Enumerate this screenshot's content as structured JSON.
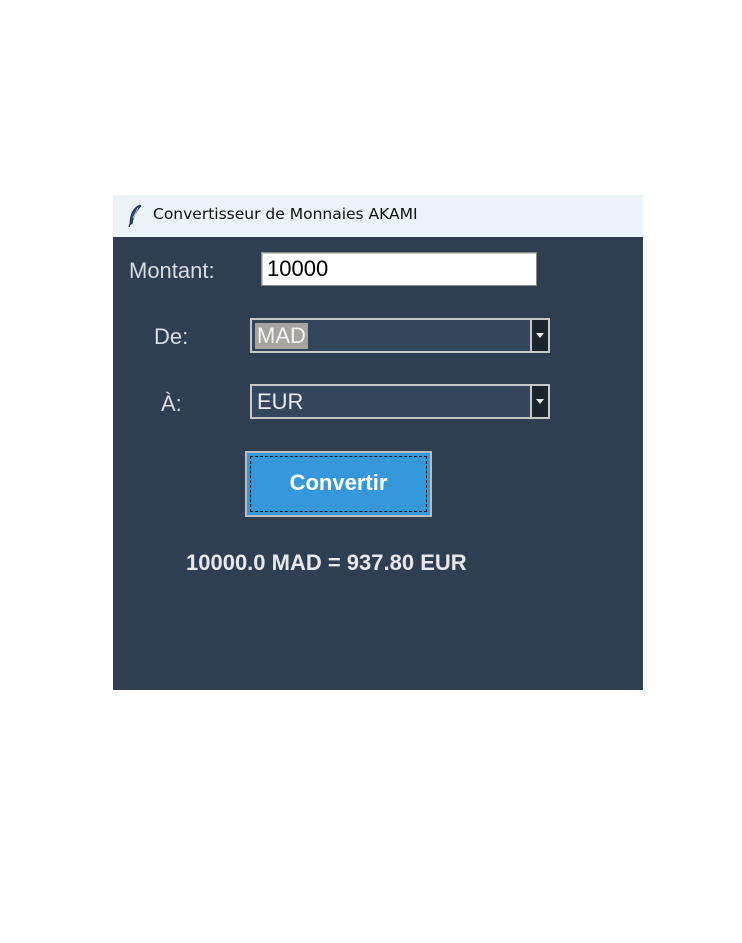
{
  "window": {
    "title": "Convertisseur de Monnaies AKAMI",
    "icon": "feather-icon"
  },
  "form": {
    "amount_label": "Montant:",
    "amount_value": "10000",
    "from_label": "De:",
    "from_value": "MAD",
    "to_label": "À:",
    "to_value": "EUR",
    "convert_label": "Convertir"
  },
  "result": {
    "text": "10000.0 MAD = 937.80 EUR"
  },
  "colors": {
    "background": "#2f3e50",
    "combo_background": "#34465b",
    "button": "#3498db",
    "titlebar": "#eaf3f8"
  }
}
